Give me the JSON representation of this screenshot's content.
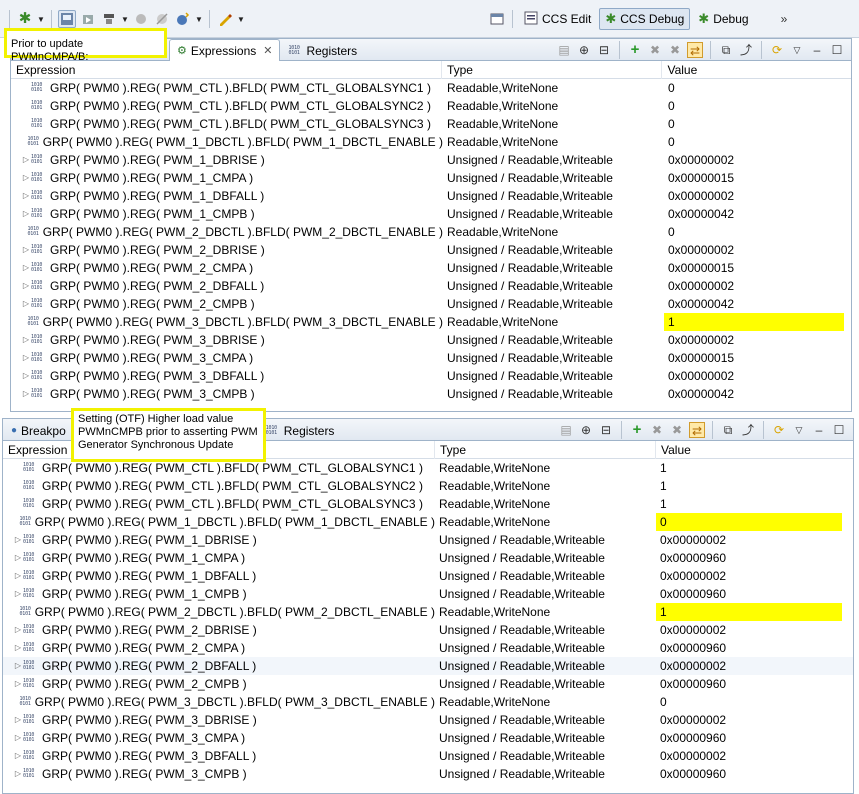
{
  "toolbar": {
    "perspectives": [
      {
        "label": "CCS Edit",
        "active": false
      },
      {
        "label": "CCS Debug",
        "active": true
      },
      {
        "label": "Debug",
        "active": false
      }
    ],
    "overflow": "»"
  },
  "notes": {
    "top": "Prior to update PWMnCMPA/B:",
    "bottom": "Setting (OTF) Higher load value PWMnCMPB prior to asserting PWM Generator Synchronous Update"
  },
  "pane1": {
    "tabs": [
      {
        "label": "Expressions",
        "icon": "expressions-icon",
        "active": true,
        "close": "✕"
      },
      {
        "label": "Registers",
        "icon": "registers-icon",
        "active": false
      }
    ],
    "columns": [
      "Expression",
      "Type",
      "Value"
    ],
    "rows": [
      {
        "expr": "GRP( PWM0 ).REG( PWM_CTL ).BFLD( PWM_CTL_GLOBALSYNC1 )",
        "type": "Readable,WriteNone",
        "value": "0",
        "expandable": false,
        "highlight": false
      },
      {
        "expr": "GRP( PWM0 ).REG( PWM_CTL ).BFLD( PWM_CTL_GLOBALSYNC2 )",
        "type": "Readable,WriteNone",
        "value": "0",
        "expandable": false,
        "highlight": false
      },
      {
        "expr": "GRP( PWM0 ).REG( PWM_CTL ).BFLD( PWM_CTL_GLOBALSYNC3 )",
        "type": "Readable,WriteNone",
        "value": "0",
        "expandable": false,
        "highlight": false
      },
      {
        "expr": "GRP( PWM0 ).REG( PWM_1_DBCTL ).BFLD( PWM_1_DBCTL_ENABLE )",
        "type": "Readable,WriteNone",
        "value": "0",
        "expandable": false,
        "highlight": false
      },
      {
        "expr": "GRP( PWM0 ).REG( PWM_1_DBRISE )",
        "type": "Unsigned / Readable,Writeable",
        "value": "0x00000002",
        "expandable": true,
        "highlight": false
      },
      {
        "expr": "GRP( PWM0 ).REG( PWM_1_CMPA )",
        "type": "Unsigned / Readable,Writeable",
        "value": "0x00000015",
        "expandable": true,
        "highlight": false
      },
      {
        "expr": "GRP( PWM0 ).REG( PWM_1_DBFALL )",
        "type": "Unsigned / Readable,Writeable",
        "value": "0x00000002",
        "expandable": true,
        "highlight": false
      },
      {
        "expr": "GRP( PWM0 ).REG( PWM_1_CMPB )",
        "type": "Unsigned / Readable,Writeable",
        "value": "0x00000042",
        "expandable": true,
        "highlight": false
      },
      {
        "expr": "GRP( PWM0 ).REG( PWM_2_DBCTL ).BFLD( PWM_2_DBCTL_ENABLE )",
        "type": "Readable,WriteNone",
        "value": "0",
        "expandable": false,
        "highlight": false
      },
      {
        "expr": "GRP( PWM0 ).REG( PWM_2_DBRISE )",
        "type": "Unsigned / Readable,Writeable",
        "value": "0x00000002",
        "expandable": true,
        "highlight": false
      },
      {
        "expr": "GRP( PWM0 ).REG( PWM_2_CMPA )",
        "type": "Unsigned / Readable,Writeable",
        "value": "0x00000015",
        "expandable": true,
        "highlight": false
      },
      {
        "expr": "GRP( PWM0 ).REG( PWM_2_DBFALL )",
        "type": "Unsigned / Readable,Writeable",
        "value": "0x00000002",
        "expandable": true,
        "highlight": false
      },
      {
        "expr": "GRP( PWM0 ).REG( PWM_2_CMPB )",
        "type": "Unsigned / Readable,Writeable",
        "value": "0x00000042",
        "expandable": true,
        "highlight": false
      },
      {
        "expr": "GRP( PWM0 ).REG( PWM_3_DBCTL ).BFLD( PWM_3_DBCTL_ENABLE )",
        "type": "Readable,WriteNone",
        "value": "1",
        "expandable": false,
        "highlight": true
      },
      {
        "expr": "GRP( PWM0 ).REG( PWM_3_DBRISE )",
        "type": "Unsigned / Readable,Writeable",
        "value": "0x00000002",
        "expandable": true,
        "highlight": false
      },
      {
        "expr": "GRP( PWM0 ).REG( PWM_3_CMPA )",
        "type": "Unsigned / Readable,Writeable",
        "value": "0x00000015",
        "expandable": true,
        "highlight": false
      },
      {
        "expr": "GRP( PWM0 ).REG( PWM_3_DBFALL )",
        "type": "Unsigned / Readable,Writeable",
        "value": "0x00000002",
        "expandable": true,
        "highlight": false
      },
      {
        "expr": "GRP( PWM0 ).REG( PWM_3_CMPB )",
        "type": "Unsigned / Readable,Writeable",
        "value": "0x00000042",
        "expandable": true,
        "highlight": false
      }
    ]
  },
  "pane2": {
    "tabs": [
      {
        "label": "Breakpo",
        "icon": "breakpoints-icon",
        "active": false
      },
      {
        "label": "Registers",
        "icon": "registers-icon",
        "active": false
      }
    ],
    "columns": [
      "Expression",
      "Type",
      "Value"
    ],
    "rows": [
      {
        "expr": "GRP( PWM0 ).REG( PWM_CTL ).BFLD( PWM_CTL_GLOBALSYNC1 )",
        "type": "Readable,WriteNone",
        "value": "1",
        "expandable": false,
        "highlight": false
      },
      {
        "expr": "GRP( PWM0 ).REG( PWM_CTL ).BFLD( PWM_CTL_GLOBALSYNC2 )",
        "type": "Readable,WriteNone",
        "value": "1",
        "expandable": false,
        "highlight": false
      },
      {
        "expr": "GRP( PWM0 ).REG( PWM_CTL ).BFLD( PWM_CTL_GLOBALSYNC3 )",
        "type": "Readable,WriteNone",
        "value": "1",
        "expandable": false,
        "highlight": false
      },
      {
        "expr": "GRP( PWM0 ).REG( PWM_1_DBCTL ).BFLD( PWM_1_DBCTL_ENABLE )",
        "type": "Readable,WriteNone",
        "value": "0",
        "expandable": false,
        "highlight": true
      },
      {
        "expr": "GRP( PWM0 ).REG( PWM_1_DBRISE )",
        "type": "Unsigned / Readable,Writeable",
        "value": "0x00000002",
        "expandable": true,
        "highlight": false
      },
      {
        "expr": "GRP( PWM0 ).REG( PWM_1_CMPA )",
        "type": "Unsigned / Readable,Writeable",
        "value": "0x00000960",
        "expandable": true,
        "highlight": false
      },
      {
        "expr": "GRP( PWM0 ).REG( PWM_1_DBFALL )",
        "type": "Unsigned / Readable,Writeable",
        "value": "0x00000002",
        "expandable": true,
        "highlight": false
      },
      {
        "expr": "GRP( PWM0 ).REG( PWM_1_CMPB )",
        "type": "Unsigned / Readable,Writeable",
        "value": "0x00000960",
        "expandable": true,
        "highlight": false
      },
      {
        "expr": "GRP( PWM0 ).REG( PWM_2_DBCTL ).BFLD( PWM_2_DBCTL_ENABLE )",
        "type": "Readable,WriteNone",
        "value": "1",
        "expandable": false,
        "highlight": true
      },
      {
        "expr": "GRP( PWM0 ).REG( PWM_2_DBRISE )",
        "type": "Unsigned / Readable,Writeable",
        "value": "0x00000002",
        "expandable": true,
        "highlight": false
      },
      {
        "expr": "GRP( PWM0 ).REG( PWM_2_CMPA )",
        "type": "Unsigned / Readable,Writeable",
        "value": "0x00000960",
        "expandable": true,
        "highlight": false
      },
      {
        "expr": "GRP( PWM0 ).REG( PWM_2_DBFALL )",
        "type": "Unsigned / Readable,Writeable",
        "value": "0x00000002",
        "expandable": true,
        "highlight": false,
        "selected": true
      },
      {
        "expr": "GRP( PWM0 ).REG( PWM_2_CMPB )",
        "type": "Unsigned / Readable,Writeable",
        "value": "0x00000960",
        "expandable": true,
        "highlight": false
      },
      {
        "expr": "GRP( PWM0 ).REG( PWM_3_DBCTL ).BFLD( PWM_3_DBCTL_ENABLE )",
        "type": "Readable,WriteNone",
        "value": "0",
        "expandable": false,
        "highlight": false
      },
      {
        "expr": "GRP( PWM0 ).REG( PWM_3_DBRISE )",
        "type": "Unsigned / Readable,Writeable",
        "value": "0x00000002",
        "expandable": true,
        "highlight": false
      },
      {
        "expr": "GRP( PWM0 ).REG( PWM_3_CMPA )",
        "type": "Unsigned / Readable,Writeable",
        "value": "0x00000960",
        "expandable": true,
        "highlight": false
      },
      {
        "expr": "GRP( PWM0 ).REG( PWM_3_DBFALL )",
        "type": "Unsigned / Readable,Writeable",
        "value": "0x00000002",
        "expandable": true,
        "highlight": false
      },
      {
        "expr": "GRP( PWM0 ).REG( PWM_3_CMPB )",
        "type": "Unsigned / Readable,Writeable",
        "value": "0x00000960",
        "expandable": true,
        "highlight": false
      }
    ]
  },
  "colors": {
    "highlight": "#ffff00",
    "note_border": "#f2f200",
    "accent": "#9fb3c9"
  },
  "icons": {
    "expand": "▷",
    "register": "register-icon"
  }
}
